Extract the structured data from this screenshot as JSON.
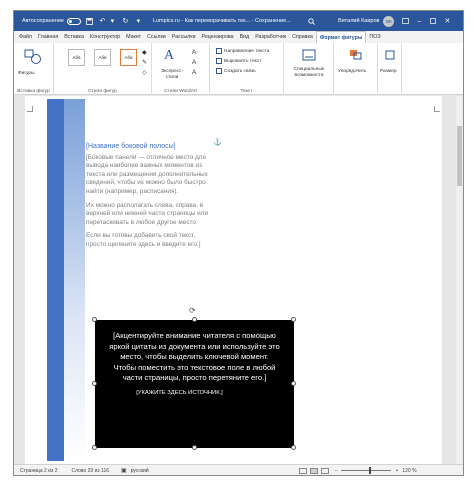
{
  "titlebar": {
    "autosave": "Автосохранение",
    "autosave_state": "off",
    "doc_title": "Lumpics.ru - Как переворачивать тек... - Сохранение...",
    "user": "Виталий Каиров",
    "avatar": "ВК"
  },
  "tabs": [
    "Файл",
    "Главная",
    "Вставка",
    "Конструктор",
    "Макет",
    "Ссылки",
    "Рассылки",
    "Рецензирова",
    "Вид",
    "Разработчик",
    "Справка",
    "Формат фигуры",
    "ПОЗ"
  ],
  "active_tab": "Формат фигуры",
  "ribbon": {
    "insert_shapes": {
      "button": "Фигуры",
      "label": "Вставка фигур"
    },
    "shape_styles": {
      "swatches": [
        "Абв",
        "Абв",
        "Абв"
      ],
      "label": "Стили фигур"
    },
    "wordart": {
      "button": "Экспресс-стили",
      "label": "Стили WordArt"
    },
    "text": {
      "direction": "Направление текста",
      "align": "Выровнять текст",
      "link": "Создать связь",
      "label": "Текст"
    },
    "special": {
      "button": "Специальные возможности"
    },
    "arrange": {
      "button": "Упорядочить"
    },
    "size": {
      "button": "Размер"
    }
  },
  "sidebar": {
    "title": "[Название боковой полосы]",
    "paragraphs": [
      "[Боковые панели — отличное место для вывода наиболее важных моментов из текста или размещения дополнительных сведений, чтобы их можно было быстро найти (например, расписания).",
      "Их можно располагать слева, справа, в верхней или нижней части страницы или перетаскивать в любое другое место.",
      "Если вы готовы добавить свой текст, просто щелкните здесь и введите его.]"
    ]
  },
  "quote": {
    "text": "[Акцентируйте внимание читателя с помощью яркой цитаты из документа или используйте это место, чтобы выделить ключевой момент. Чтобы поместить это текстовое поле в любой части страницы, просто перетяните его.]",
    "source": "[УКАЖИТЕ ЗДЕСЬ ИСТОЧНИК.]"
  },
  "statusbar": {
    "page": "Страница 2 из 2",
    "words": "Слово 29 из 116",
    "language": "русский",
    "zoom": "120 %"
  },
  "colors": {
    "titlebar": "#2b579a",
    "sidebar_accent": "#4472c4",
    "quote_background": "#000000"
  }
}
